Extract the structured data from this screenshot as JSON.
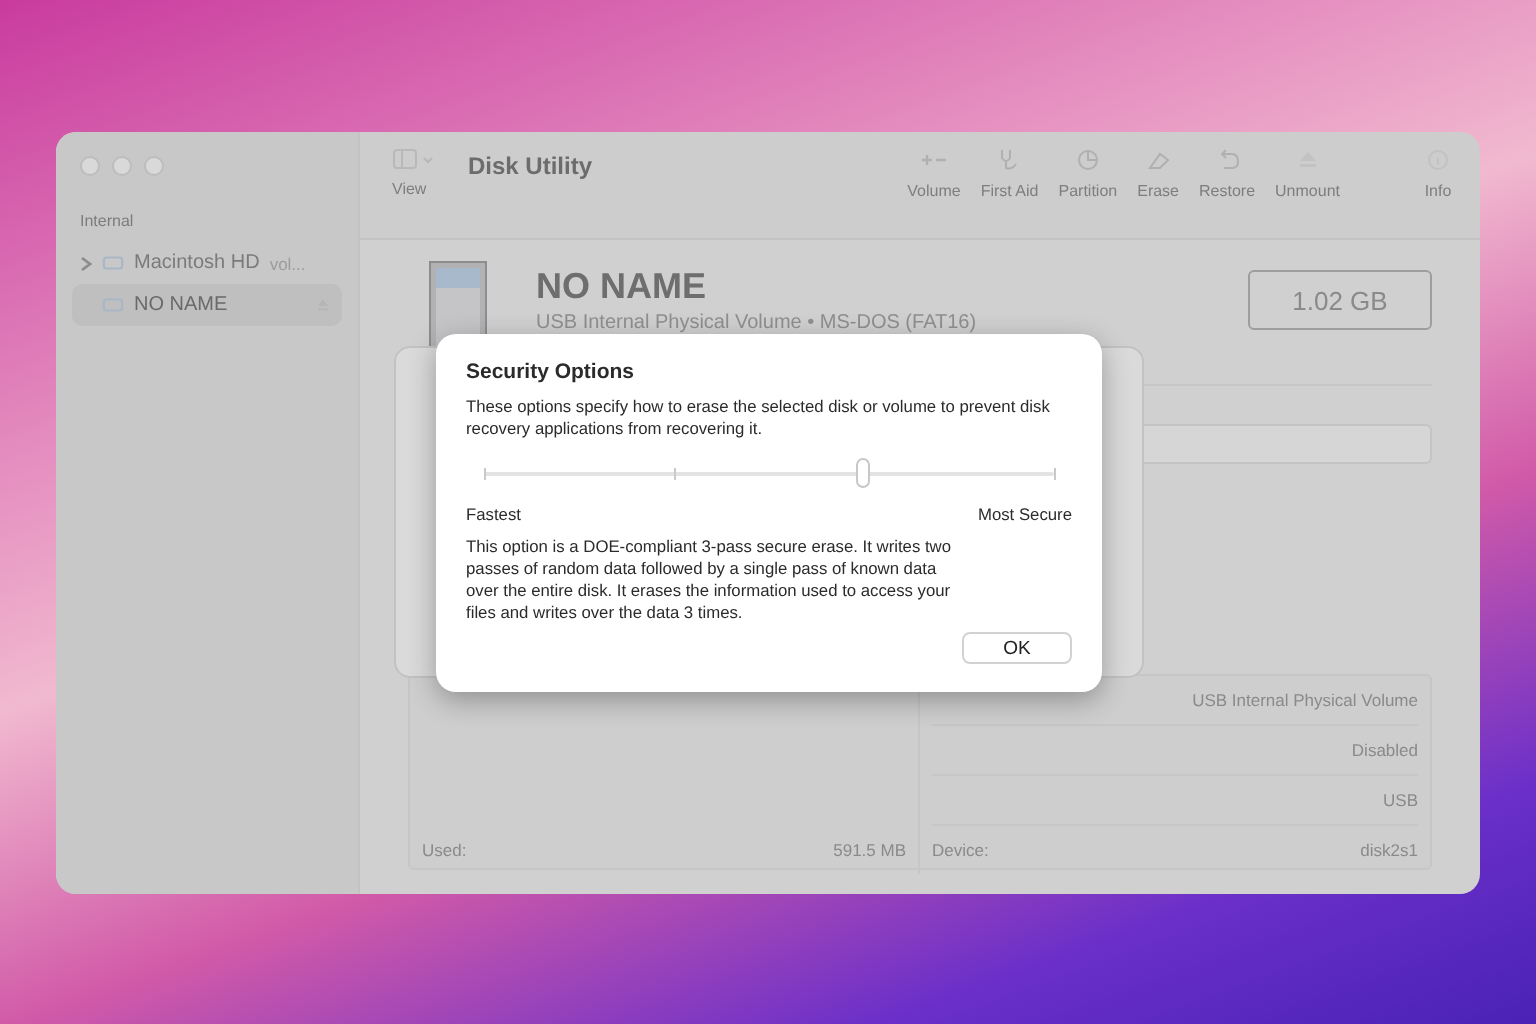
{
  "window": {
    "title": "Disk Utility"
  },
  "toolbar": {
    "view_label": "View",
    "buttons": [
      {
        "label": "Volume"
      },
      {
        "label": "First Aid"
      },
      {
        "label": "Partition"
      },
      {
        "label": "Erase"
      },
      {
        "label": "Restore"
      },
      {
        "label": "Unmount"
      }
    ],
    "info_label": "Info"
  },
  "sidebar": {
    "section": "Internal",
    "items": [
      {
        "name": "Macintosh HD",
        "detail": "vol...",
        "selected": false,
        "expanded": false
      },
      {
        "name": "NO NAME",
        "selected": true
      }
    ]
  },
  "volume": {
    "name": "NO NAME",
    "subtitle": "USB Internal Physical Volume • MS-DOS (FAT16)",
    "size": "1.02 GB"
  },
  "info": {
    "left": [
      {
        "label": "Used:",
        "value": "591.5 MB"
      }
    ],
    "right": [
      {
        "value": "USB Internal Physical Volume"
      },
      {
        "value": "Disabled"
      },
      {
        "value": "USB"
      },
      {
        "label": "Device:",
        "value": "disk2s1"
      }
    ]
  },
  "dialog": {
    "title": "Security Options",
    "description": "These options specify how to erase the selected disk or volume to prevent disk recovery applications from recovering it.",
    "slider": {
      "level": 0.6667,
      "min_label": "Fastest",
      "max_label": "Most Secure"
    },
    "explanation": "This option is a DOE-compliant 3-pass secure erase. It writes two passes of random data followed by a single pass of known data over the entire disk. It erases the information used to access your files and writes over the data 3 times.",
    "button": "OK"
  }
}
